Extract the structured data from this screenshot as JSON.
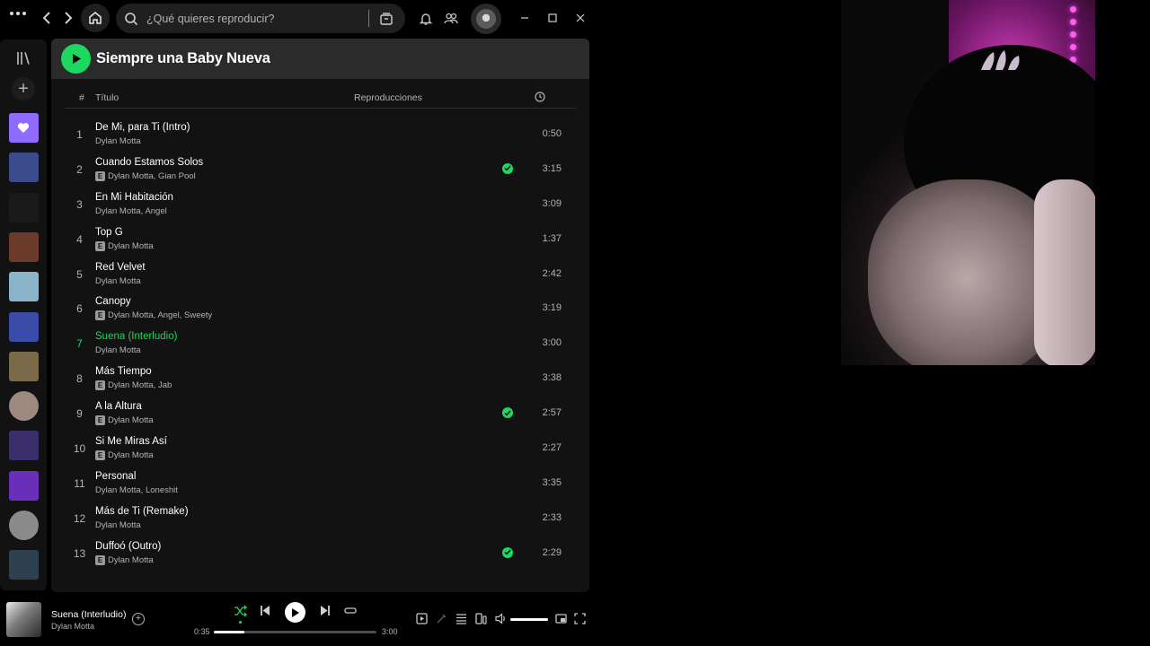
{
  "search": {
    "placeholder": "¿Qué quieres reproducir?"
  },
  "playlist": {
    "title": "Siempre una Baby Nueva"
  },
  "columns": {
    "number": "#",
    "title": "Título",
    "plays": "Reproducciones"
  },
  "tracks": [
    {
      "num": "1",
      "title": "De Mi, para Ti (Intro)",
      "artist": "Dylan Motta",
      "explicit": false,
      "saved": false,
      "duration": "0:50"
    },
    {
      "num": "2",
      "title": "Cuando Estamos Solos",
      "artist": "Dylan Motta, Gian Pool",
      "explicit": true,
      "saved": true,
      "duration": "3:15"
    },
    {
      "num": "3",
      "title": "En Mi Habitación",
      "artist": "Dylan Motta, Angel",
      "explicit": false,
      "saved": false,
      "duration": "3:09"
    },
    {
      "num": "4",
      "title": "Top G",
      "artist": "Dylan Motta",
      "explicit": true,
      "saved": false,
      "duration": "1:37"
    },
    {
      "num": "5",
      "title": "Red Velvet",
      "artist": "Dylan Motta",
      "explicit": false,
      "saved": false,
      "duration": "2:42"
    },
    {
      "num": "6",
      "title": "Canopy",
      "artist": "Dylan Motta, Angel, Sweety",
      "explicit": true,
      "saved": false,
      "duration": "3:19"
    },
    {
      "num": "7",
      "title": "Suena (Interludio)",
      "artist": "Dylan Motta",
      "explicit": false,
      "saved": false,
      "duration": "3:00"
    },
    {
      "num": "8",
      "title": "Más Tiempo",
      "artist": "Dylan Motta, Jab",
      "explicit": true,
      "saved": false,
      "duration": "3:38"
    },
    {
      "num": "9",
      "title": "A la Altura",
      "artist": "Dylan Motta",
      "explicit": true,
      "saved": true,
      "duration": "2:57"
    },
    {
      "num": "10",
      "title": "Si Me Miras Así",
      "artist": "Dylan Motta",
      "explicit": true,
      "saved": false,
      "duration": "2:27"
    },
    {
      "num": "11",
      "title": "Personal",
      "artist": "Dylan Motta, Loneshit",
      "explicit": false,
      "saved": false,
      "duration": "3:35"
    },
    {
      "num": "12",
      "title": "Más de Ti (Remake)",
      "artist": "Dylan Motta",
      "explicit": false,
      "saved": false,
      "duration": "2:33"
    },
    {
      "num": "13",
      "title": "Duffoó (Outro)",
      "artist": "Dylan Motta",
      "explicit": true,
      "saved": true,
      "duration": "2:29"
    }
  ],
  "active_track_index": 6,
  "explicit_badge": "E",
  "now_playing": {
    "title": "Suena (Interludio)",
    "artist": "Dylan Motta",
    "elapsed": "0:35",
    "total": "3:00",
    "progress_fraction": 0.19,
    "volume_fraction": 1.0
  },
  "colors": {
    "accent": "#1ed760",
    "panel": "#121212",
    "header": "#2b2b2b"
  },
  "library_thumbs": [
    "#8f6bff",
    "#3a4b8c",
    "#1a1a1a",
    "#6b3a2a",
    "#8cb4c8",
    "#3a4ca8",
    "#7a6a4a",
    "#9c8a80",
    "#3b2f6b",
    "#6a2fb8",
    "#8a8a8a",
    "#2c4050"
  ]
}
